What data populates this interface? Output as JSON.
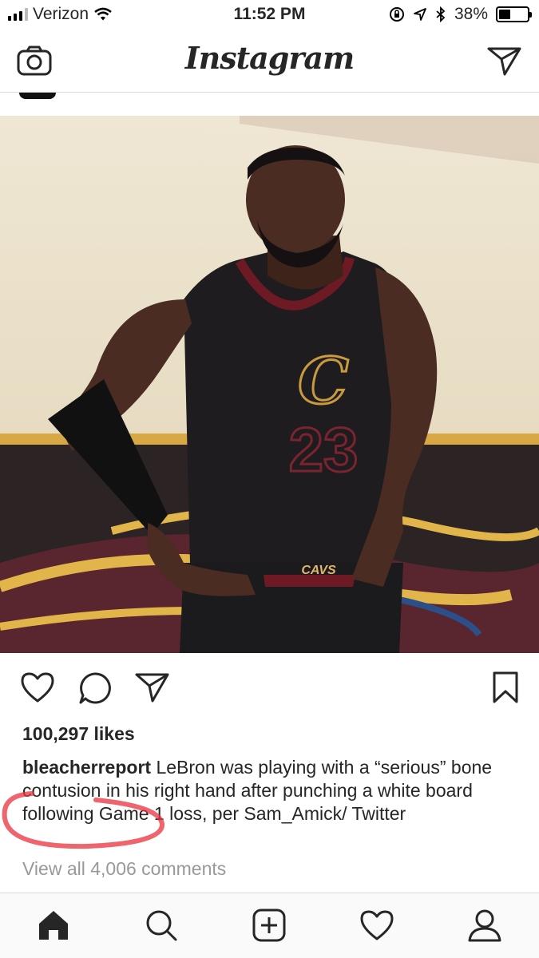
{
  "status_bar": {
    "carrier": "Verizon",
    "time": "11:52 PM",
    "battery_percent": "38%",
    "icons": [
      "signal-bars-icon",
      "wifi-icon",
      "orientation-lock-icon",
      "location-icon",
      "bluetooth-icon",
      "battery-icon"
    ]
  },
  "header": {
    "logo": "Instagram",
    "icons": [
      "camera-icon",
      "direct-message-icon"
    ]
  },
  "post": {
    "image_description_icon": "photo",
    "actions": [
      "heart-icon",
      "comment-icon",
      "share-icon",
      "bookmark-icon"
    ],
    "likes": "100,297 likes",
    "username": "bleacherreport",
    "caption": " LeBron was playing with a “serious” bone contusion in his right hand after punching a white board following Game 1 loss, per Sam_Amick/ Twitter",
    "view_comments": "View all 4,006 comments",
    "jersey_text": "CAVS",
    "jersey_number": "23",
    "highlight_color": "#e8323c"
  },
  "tabbar": {
    "tabs": [
      "home-icon",
      "search-icon",
      "new-post-icon",
      "activity-heart-icon",
      "profile-icon"
    ]
  }
}
